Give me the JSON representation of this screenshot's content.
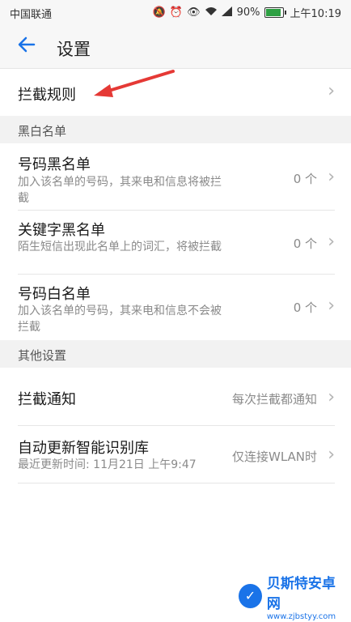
{
  "status": {
    "carrier": "中国联通",
    "battery": "90%",
    "battery_level": 0.9,
    "time": "上午10:19",
    "icons": [
      "mute-icon",
      "alarm-icon",
      "eye-icon",
      "wifi-icon",
      "signal-icon",
      "battery-icon"
    ]
  },
  "header": {
    "title": "设置"
  },
  "rule": {
    "label": "拦截规则"
  },
  "blackwhite": {
    "section_title": "黑白名单",
    "items": [
      {
        "label": "号码黑名单",
        "sub": "加入该名单的号码，其来电和信息将被拦截",
        "value": "0 个"
      },
      {
        "label": "关键字黑名单",
        "sub": "陌生短信出现此名单上的词汇，将被拦截",
        "value": "0 个"
      },
      {
        "label": "号码白名单",
        "sub": "加入该名单的号码，其来电和信息不会被拦截",
        "value": "0 个"
      }
    ]
  },
  "other": {
    "section_title": "其他设置",
    "notify": {
      "label": "拦截通知",
      "value": "每次拦截都通知"
    },
    "update": {
      "label": "自动更新智能识别库",
      "sub": "最近更新时间: 11月21日 上午9:47",
      "value": "仅连接WLAN时"
    }
  },
  "watermark": {
    "main": "贝斯特安卓网",
    "url": "www.zjbstyy.com"
  },
  "colors": {
    "accent": "#1a73e8",
    "arrow": "#e53935"
  }
}
